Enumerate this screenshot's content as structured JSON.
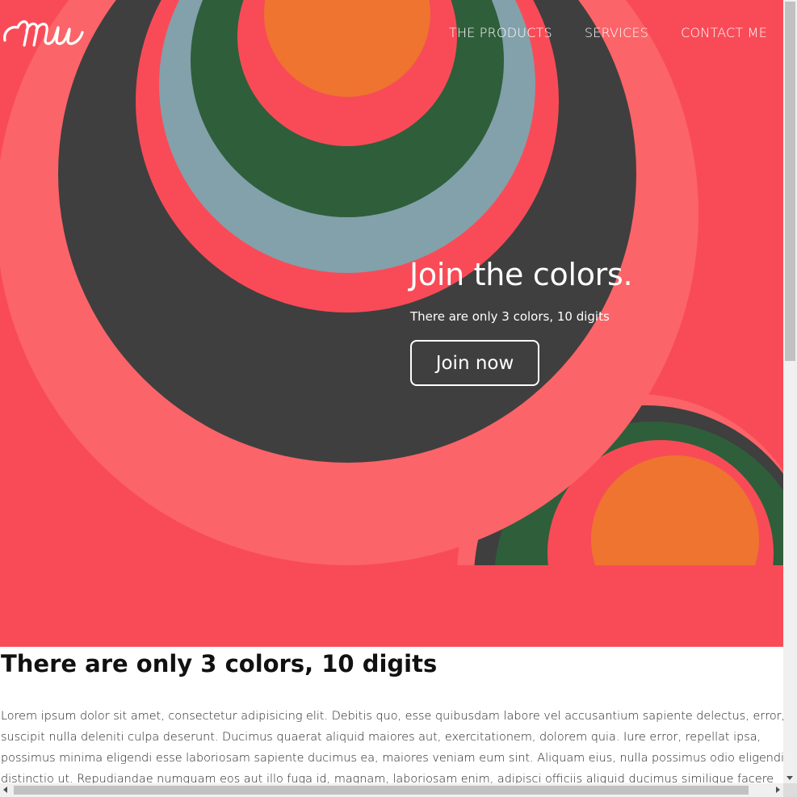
{
  "logo": {
    "icon": "script-mw-logo"
  },
  "nav": {
    "items": [
      {
        "label": "THE PRODUCTS"
      },
      {
        "label": "SERVICES"
      },
      {
        "label": "CONTACT ME"
      }
    ]
  },
  "hero": {
    "title": "Join the colors.",
    "subtitle": "There are only 3 colors, 10 digits",
    "cta_label": "Join now",
    "colors": {
      "background": "#f94b57",
      "light_coral": "#fb6468",
      "charcoal": "#3f3f3f",
      "slate": "#82a1ab",
      "green": "#2f5e3b",
      "orange": "#ee7430"
    }
  },
  "content": {
    "heading": "There are only 3 colors, 10 digits",
    "paragraph": "Lorem ipsum dolor sit amet, consectetur adipisicing elit. Debitis quo, esse quibusdam labore vel accusantium sapiente delectus, error, h suscipit nulla deleniti culpa deserunt. Ducimus quaerat aliquid maiores aut, exercitationem, dolorem quia. Iure error, repellat ipsa, possimus minima eligendi esse laboriosam sapiente ducimus ea, maiores veniam eum sint. Aliquam eius, nulla possimus odio eligendi, distinctio ut. Repudiandae numquam eos aut illo fuga id, magnam, laboriosam enim, adipisci officiis aliquid ducimus similique facere ipsa"
  }
}
